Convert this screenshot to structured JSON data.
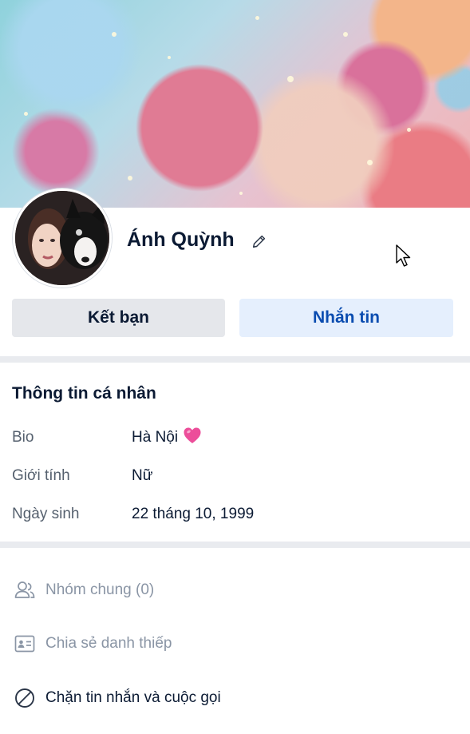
{
  "profile": {
    "name": "Ánh Quỳnh",
    "add_friend_label": "Kết bạn",
    "message_label": "Nhắn tin"
  },
  "personal_info": {
    "title": "Thông tin cá nhân",
    "rows": [
      {
        "label": "Bio",
        "value": "Hà Nội"
      },
      {
        "label": "Giới tính",
        "value": "Nữ"
      },
      {
        "label": "Ngày sinh",
        "value": "22 tháng 10, 1999"
      }
    ]
  },
  "actions": [
    {
      "label": "Nhóm chung (0)",
      "icon": "group-icon"
    },
    {
      "label": "Chia sẻ danh thiếp",
      "icon": "contact-card-icon"
    },
    {
      "label": "Chặn tin nhắn và cuộc gọi",
      "icon": "block-icon"
    }
  ],
  "colors": {
    "message_button_bg": "#e5effd",
    "message_button_text": "#0a4cb0",
    "friend_button_bg": "#e5e7eb",
    "heart": "#ec4e9a"
  }
}
